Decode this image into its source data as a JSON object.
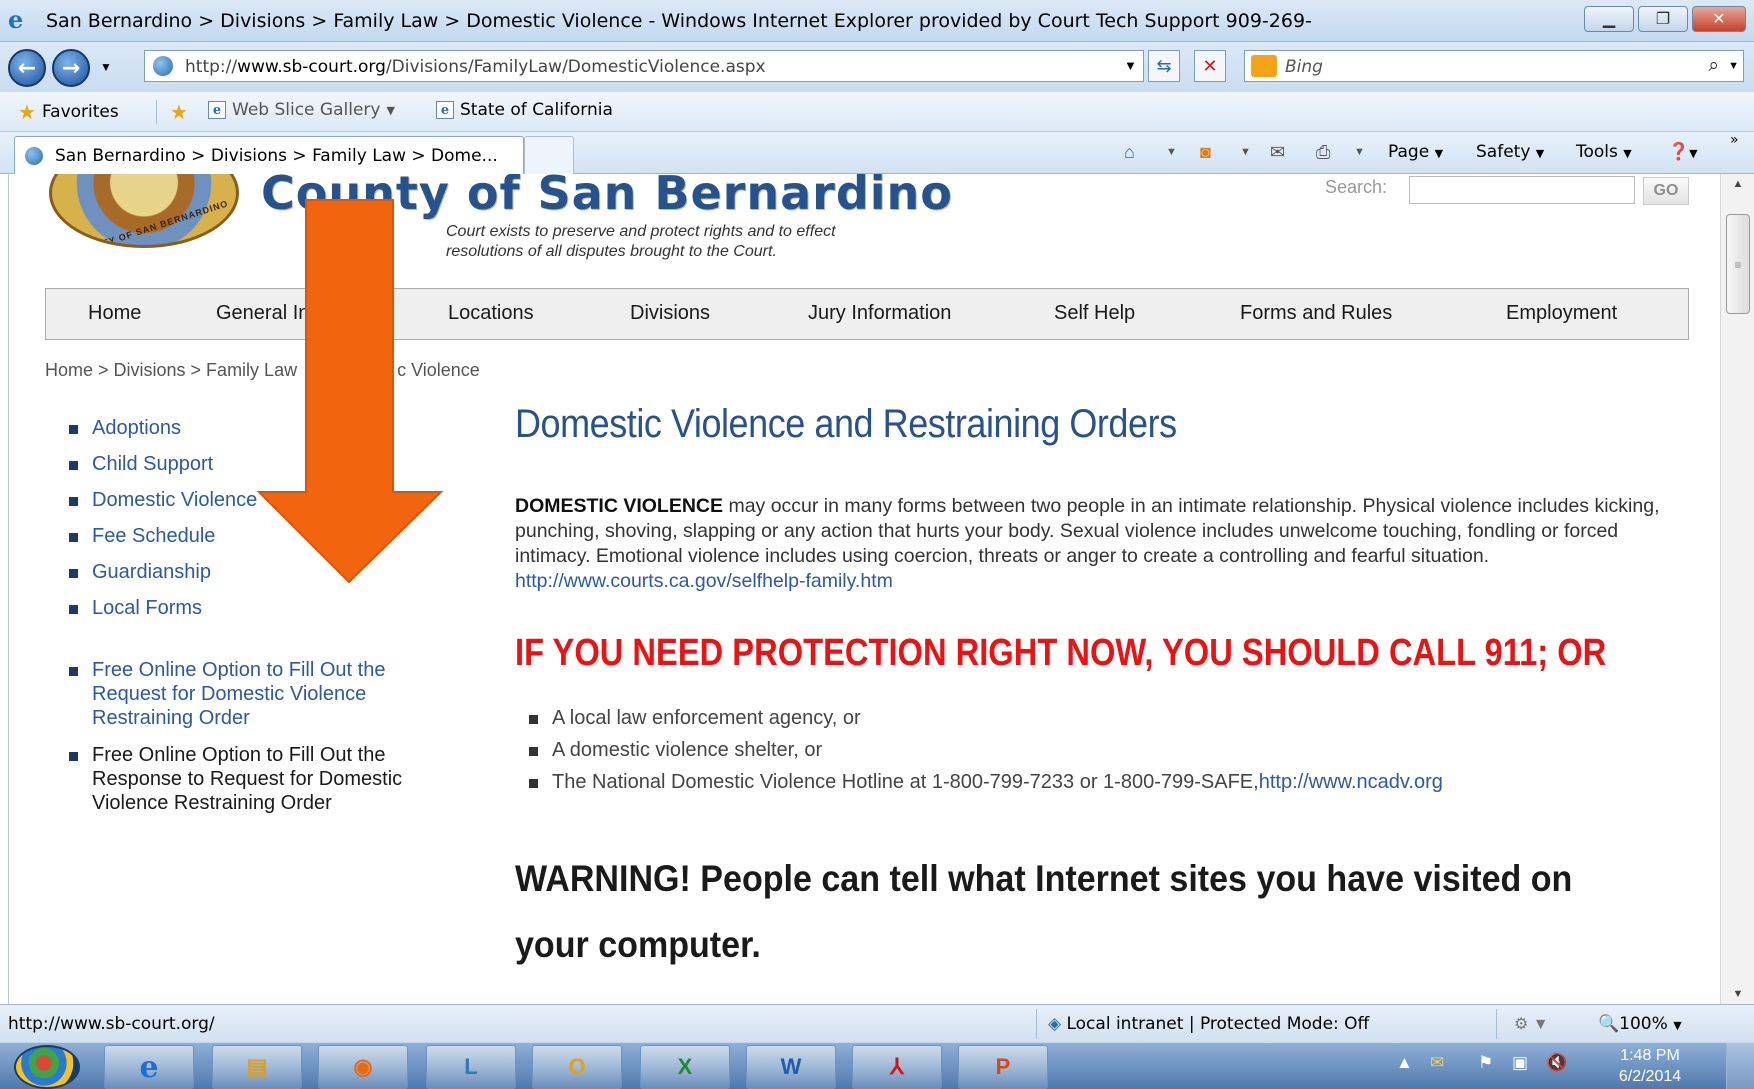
{
  "window": {
    "title": "San Bernardino > Divisions > Family Law > Domestic Violence - Windows Internet Explorer provided by Court Tech Support 909-269-",
    "controls": [
      "minimize",
      "restore",
      "close"
    ]
  },
  "address_bar": {
    "url_prefix": "http://",
    "url_host": "www.sb-court.org",
    "url_path": "/Divisions/FamilyLaw/DomesticViolence.aspx",
    "search_provider": "Bing"
  },
  "favorites_bar": {
    "favorites_label": "Favorites",
    "items": [
      "Web Slice Gallery",
      "State of California"
    ]
  },
  "tab": {
    "label": "San Bernardino > Divisions > Family Law > Dome..."
  },
  "command_bar": {
    "items": [
      "Page",
      "Safety",
      "Tools"
    ]
  },
  "site": {
    "seal_text": "COUNTY OF SAN BERNARDINO",
    "title": "County of San Bernardino",
    "mission_line1": "Court exists to preserve and protect rights and to effect",
    "mission_line2": "resolutions of all disputes brought to the Court.",
    "search_label": "Search:",
    "search_button": "GO",
    "nav": [
      "Home",
      "General In",
      "Locations",
      "Divisions",
      "Jury Information",
      "Self Help",
      "Forms and Rules",
      "Employment"
    ],
    "breadcrumb": "Home > Divisions > Family Law",
    "breadcrumb_tail": "c Violence"
  },
  "sidebar": {
    "links": [
      "Adoptions",
      "Child Support",
      "Domestic Violence",
      "Fee Schedule",
      "Guardianship",
      "Local Forms"
    ],
    "option_request": "Free Online Option to Fill Out the Request for Domestic Violence Restraining Order",
    "option_response": "Free Online Option to Fill Out the Response to Request for Domestic Violence Restraining Order"
  },
  "main": {
    "heading": "Domestic Violence and Restraining Orders",
    "para_lead": "DOMESTIC VIOLENCE",
    "para_body": " may occur in many forms between two people in an intimate relationship. Physical violence includes kicking, punching, shoving, slapping or any action that hurts your body. Sexual violence includes unwelcome touching, fondling or forced intimacy. Emotional violence includes using coercion, threats or anger to create a controlling and fearful situation. ",
    "para_link": "http://www.courts.ca.gov/selfhelp-family.htm",
    "alert": "IF YOU NEED PROTECTION RIGHT NOW, YOU SHOULD CALL 911; OR",
    "help_items": [
      "A local law enforcement agency, or",
      "A domestic violence shelter, or"
    ],
    "hotline_text": "The National Domestic Violence Hotline at 1-800-799-7233 or 1-800-799-SAFE,",
    "hotline_link": "http://www.ncadv.org",
    "warning": "WARNING! People can tell what Internet sites you have visited on your computer."
  },
  "status_bar": {
    "url": "http://www.sb-court.org/",
    "zone": "Local intranet | Protected Mode: Off",
    "zoom": "100%"
  },
  "taskbar": {
    "time": "1:48 PM",
    "date": "6/2/2014"
  },
  "annotation": {
    "color": "#f0650e"
  }
}
